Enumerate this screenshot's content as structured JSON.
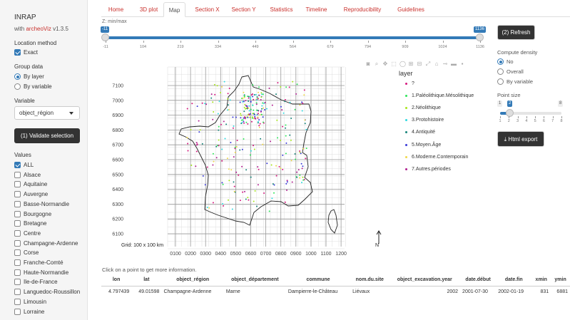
{
  "app": {
    "title": "INRAP",
    "subtitle_prefix": "with ",
    "subtitle_link": "archeoViz",
    "subtitle_version": " v1.3.5"
  },
  "sidebar": {
    "location_method_label": "Location method",
    "exact_label": "Exact",
    "group_data_label": "Group data",
    "by_layer_label": "By layer",
    "by_variable_label": "By variable",
    "variable_label": "Variable",
    "variable_value": "object_région",
    "validate_button": "(1) Validate selection",
    "values_label": "Values",
    "values": [
      {
        "label": "ALL",
        "checked": true
      },
      {
        "label": "Alsace",
        "checked": false
      },
      {
        "label": "Aquitaine",
        "checked": false
      },
      {
        "label": "Auvergne",
        "checked": false
      },
      {
        "label": "Basse-Normandie",
        "checked": false
      },
      {
        "label": "Bourgogne",
        "checked": false
      },
      {
        "label": "Bretagne",
        "checked": false
      },
      {
        "label": "Centre",
        "checked": false
      },
      {
        "label": "Champagne-Ardenne",
        "checked": false
      },
      {
        "label": "Corse",
        "checked": false
      },
      {
        "label": "Franche-Comté",
        "checked": false
      },
      {
        "label": "Haute-Normandie",
        "checked": false
      },
      {
        "label": "Ile-de-France",
        "checked": false
      },
      {
        "label": "Languedoc-Roussillon",
        "checked": false
      },
      {
        "label": "Limousin",
        "checked": false
      },
      {
        "label": "Lorraine",
        "checked": false
      }
    ]
  },
  "tabs": [
    {
      "label": "Home",
      "active": false
    },
    {
      "label": "3D plot",
      "active": false
    },
    {
      "label": "Map",
      "active": true
    },
    {
      "label": "Section X",
      "active": false
    },
    {
      "label": "Section Y",
      "active": false
    },
    {
      "label": "Statistics",
      "active": false
    },
    {
      "label": "Timeline",
      "active": false
    },
    {
      "label": "Reproducibility",
      "active": false
    },
    {
      "label": "Guidelines",
      "active": false
    }
  ],
  "zslider": {
    "label": "Z: min/max",
    "min_value": "-11",
    "max_value": "1136",
    "ticks": [
      "-11",
      "104",
      "219",
      "334",
      "449",
      "564",
      "679",
      "794",
      "909",
      "1024",
      "1136"
    ]
  },
  "right_panel": {
    "refresh_button": "(2) Refresh",
    "compute_density_label": "Compute density",
    "density_options": [
      {
        "label": "No",
        "selected": true
      },
      {
        "label": "Overall",
        "selected": false
      },
      {
        "label": "By variable",
        "selected": false
      }
    ],
    "point_size_label": "Point size",
    "point_size_min": "1",
    "point_size_value": "2",
    "point_size_max": "8",
    "point_size_ticks": [
      "1",
      "2",
      "3",
      "4",
      "5",
      "6",
      "7",
      "8"
    ],
    "export_button": "Html export"
  },
  "map": {
    "y_ticks": [
      "7100",
      "7000",
      "6900",
      "6800",
      "6700",
      "6600",
      "6500",
      "6400",
      "6300",
      "6200",
      "6100"
    ],
    "x_ticks": [
      "0100",
      "0200",
      "0300",
      "0400",
      "0500",
      "0600",
      "0700",
      "0800",
      "0900",
      "1000",
      "1100",
      "1200"
    ],
    "grid_label": "Grid: 100 x 100 km",
    "north_label": "N",
    "legend_title": "layer",
    "legend": [
      {
        "label": "?",
        "color": "#d6187e"
      },
      {
        "label": "1.Paléolithique.Mésolithique",
        "color": "#2ee65a"
      },
      {
        "label": "2.Néolithique",
        "color": "#a7e61b"
      },
      {
        "label": "3.Protohistoire",
        "color": "#2fd9e0"
      },
      {
        "label": "4.Antiquité",
        "color": "#17857a"
      },
      {
        "label": "5.Moyen.Âge",
        "color": "#3a3ad8"
      },
      {
        "label": "6.Moderne.Contemporain",
        "color": "#f0d84a"
      },
      {
        "label": "7.Autres.périodes",
        "color": "#b02090"
      }
    ],
    "modebar_icons": [
      "camera-icon",
      "zoom-icon",
      "pan-icon",
      "box-select-icon",
      "lasso-icon",
      "zoom-in-icon",
      "zoom-out-icon",
      "autoscale-icon",
      "reset-axes-icon",
      "toggle-spike-icon",
      "hover-closest-icon",
      "plotly-logo-icon"
    ]
  },
  "info_text": "Click on a point to get more information.",
  "table": {
    "headers": [
      "lon",
      "lat",
      "object_région",
      "object_département",
      "commune",
      "nom.du.site",
      "object_excavation.year",
      "date.début",
      "date.fin",
      "xmin",
      "ymin"
    ],
    "row": [
      "4.797439",
      "49.01598",
      "Champagne-Ardenne",
      "Marne",
      "Dampierre-le-Château",
      "Liévaux",
      "2002",
      "2001-07-30",
      "2002-01-19",
      "831",
      "6881"
    ]
  }
}
